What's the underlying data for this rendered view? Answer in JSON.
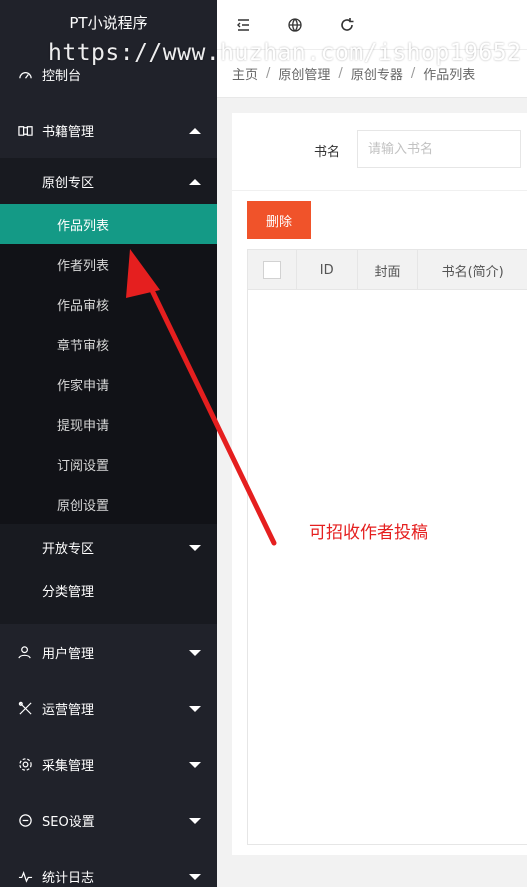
{
  "app": {
    "title": "PT小说程序"
  },
  "watermark": "https://www.huzhan.com/ishop19652",
  "sidebar": {
    "dashboard": {
      "label": "控制台",
      "icon": "gauge-icon"
    },
    "books": {
      "label": "书籍管理",
      "icon": "book-icon",
      "original": {
        "label": "原创专区",
        "items": [
          "作品列表",
          "作者列表",
          "作品审核",
          "章节审核",
          "作家申请",
          "提现申请",
          "订阅设置",
          "原创设置"
        ],
        "active_index": 0
      },
      "open_zone": {
        "label": "开放专区"
      },
      "category": {
        "label": "分类管理"
      }
    },
    "users": {
      "label": "用户管理",
      "icon": "user-icon"
    },
    "operations": {
      "label": "运营管理",
      "icon": "tools-icon"
    },
    "collect": {
      "label": "采集管理",
      "icon": "gear-icon"
    },
    "seo": {
      "label": "SEO设置",
      "icon": "seo-icon"
    },
    "stats": {
      "label": "统计日志",
      "icon": "pulse-icon"
    }
  },
  "header": {
    "icons": [
      "menu-fold-icon",
      "globe-icon",
      "refresh-icon"
    ]
  },
  "breadcrumb": [
    "主页",
    "原创管理",
    "原创专器",
    "作品列表"
  ],
  "search": {
    "label": "书名",
    "placeholder": "请输入书名",
    "value": ""
  },
  "toolbar": {
    "delete_label": "删除"
  },
  "table": {
    "columns": [
      "",
      "ID",
      "封面",
      "书名(简介)"
    ],
    "rows": []
  },
  "annotation": {
    "text": "可招收作者投稿",
    "color": "#e51f1f"
  },
  "colors": {
    "sidebar_bg": "#20222a",
    "active_bg": "#149a86",
    "danger": "#f0532a"
  }
}
